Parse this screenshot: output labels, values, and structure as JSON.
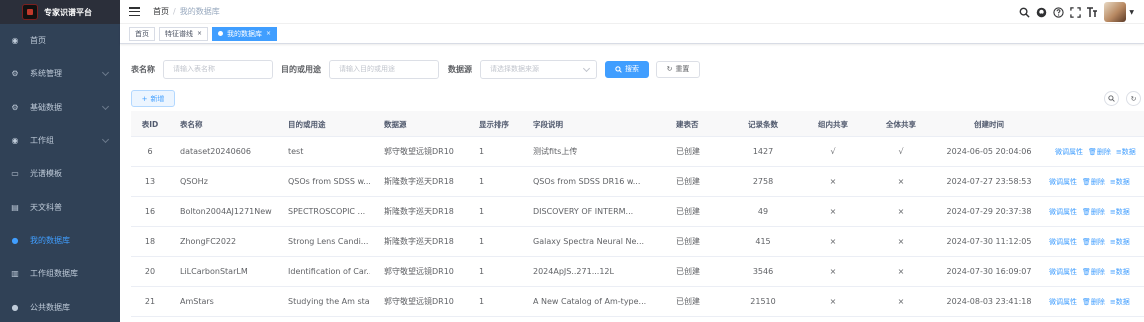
{
  "app": {
    "title": "专家识谱平台"
  },
  "sidebar": {
    "items": [
      {
        "label": "首页",
        "icon": "dashboard-icon",
        "glyph": "◉",
        "arrow": false,
        "active": false
      },
      {
        "label": "系统管理",
        "icon": "gear-icon",
        "glyph": "⚙",
        "arrow": true,
        "active": false
      },
      {
        "label": "基础数据",
        "icon": "gear-icon",
        "glyph": "⚙",
        "arrow": true,
        "active": false
      },
      {
        "label": "工作组",
        "icon": "group-icon",
        "glyph": "◉",
        "arrow": true,
        "active": false
      },
      {
        "label": "光谱模板",
        "icon": "monitor-icon",
        "glyph": "▭",
        "arrow": false,
        "active": false
      },
      {
        "label": "天文科普",
        "icon": "books-icon",
        "glyph": "▤",
        "arrow": false,
        "active": false
      },
      {
        "label": "我的数据库",
        "icon": "user-icon",
        "glyph": "●",
        "arrow": false,
        "active": true
      },
      {
        "label": "工作组数据库",
        "icon": "server-icon",
        "glyph": "▥",
        "arrow": false,
        "active": false
      },
      {
        "label": "公共数据库",
        "icon": "people-icon",
        "glyph": "●",
        "arrow": false,
        "active": false
      }
    ]
  },
  "navbar": {
    "breadcrumb": {
      "home": "首页",
      "sep": "/",
      "current": "我的数据库"
    }
  },
  "tags": [
    {
      "label": "首页",
      "active": false,
      "close": false
    },
    {
      "label": "特征谱线",
      "active": false,
      "close": true
    },
    {
      "label": "我的数据库",
      "active": true,
      "close": true
    }
  ],
  "search": {
    "table_name": {
      "label": "表名称",
      "placeholder": "请输入表名称"
    },
    "purpose": {
      "label": "目的或用途",
      "placeholder": "请输入目的或用途"
    },
    "datasource": {
      "label": "数据源",
      "placeholder": "请选择数据来源"
    },
    "search_label": "搜索",
    "reset_label": "重置"
  },
  "toolbar": {
    "add_label": "新增"
  },
  "table": {
    "columns": [
      "表ID",
      "表名称",
      "目的或用途",
      "数据源",
      "显示排序",
      "字段说明",
      "建表否",
      "记录条数",
      "组内共享",
      "全体共享",
      "创建时间"
    ],
    "actions": {
      "edit": "微调属性",
      "delete": "删除",
      "data": "数据"
    },
    "rows": [
      {
        "id": "6",
        "name": "dataset20240606",
        "purpose": "test",
        "source": "郭守敬望远镜DR10",
        "order": "1",
        "desc": "测试fits上传",
        "built": "已创建",
        "count": "1427",
        "group": "√",
        "all": "√",
        "created": "2024-06-05 20:04:06"
      },
      {
        "id": "13",
        "name": "QSOHz",
        "purpose": "QSOs from SDSS w...",
        "source": "斯隆数字巡天DR18",
        "order": "1",
        "desc": "QSOs from SDSS DR16 w...",
        "built": "已创建",
        "count": "2758",
        "group": "×",
        "all": "×",
        "created": "2024-07-27 23:58:53"
      },
      {
        "id": "16",
        "name": "Bolton2004AJ1271New",
        "purpose": "SPECTROSCOPIC ...",
        "source": "斯隆数字巡天DR18",
        "order": "1",
        "desc": "DISCOVERY OF INTERM...",
        "built": "已创建",
        "count": "49",
        "group": "×",
        "all": "×",
        "created": "2024-07-29 20:37:38"
      },
      {
        "id": "18",
        "name": "ZhongFC2022",
        "purpose": "Strong Lens Candi...",
        "source": "斯隆数字巡天DR18",
        "order": "1",
        "desc": "Galaxy Spectra Neural Ne...",
        "built": "已创建",
        "count": "415",
        "group": "×",
        "all": "×",
        "created": "2024-07-30 11:12:05"
      },
      {
        "id": "20",
        "name": "LiLCarbonStarLM",
        "purpose": "Identification of Car...",
        "source": "郭守敬望远镜DR10",
        "order": "1",
        "desc": "2024ApJS..271...12L",
        "built": "已创建",
        "count": "3546",
        "group": "×",
        "all": "×",
        "created": "2024-07-30 16:09:07"
      },
      {
        "id": "21",
        "name": "AmStars",
        "purpose": "Studying the Am stars",
        "source": "郭守敬望远镜DR10",
        "order": "1",
        "desc": "A New Catalog of Am-type...",
        "built": "已创建",
        "count": "21510",
        "group": "×",
        "all": "×",
        "created": "2024-08-03 23:41:18"
      }
    ]
  }
}
